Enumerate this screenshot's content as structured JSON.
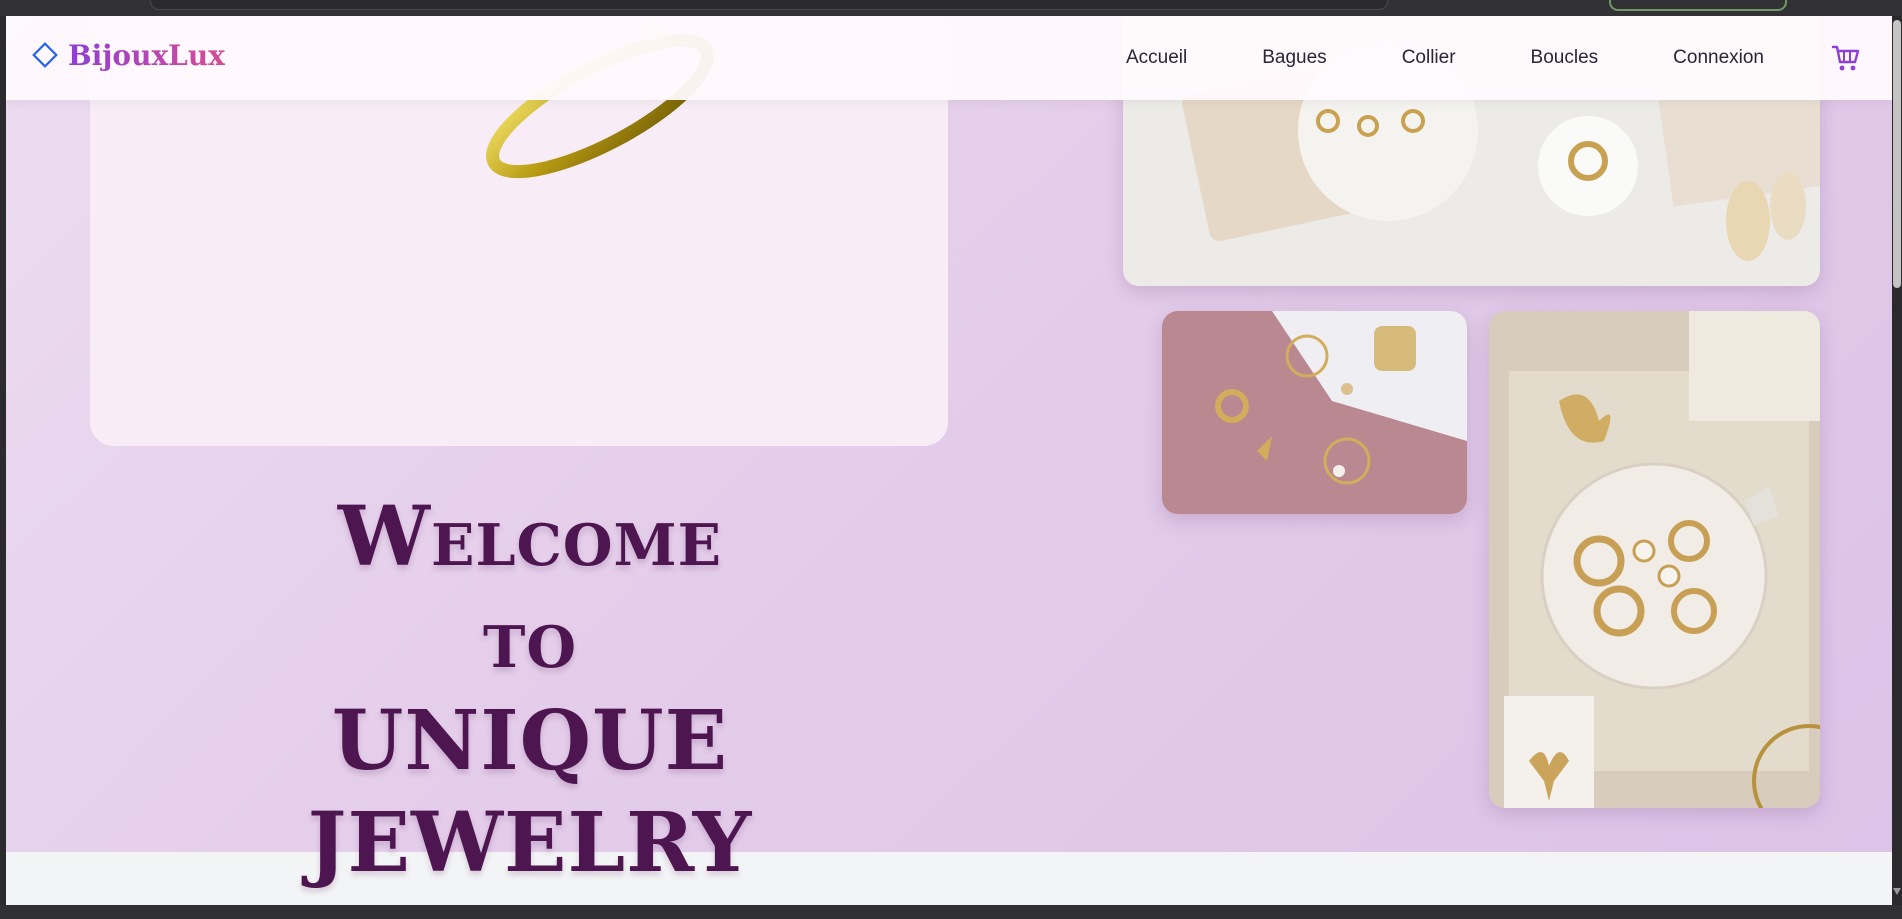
{
  "brand": {
    "name": "BijouxLux",
    "icon": "diamond-outline-icon"
  },
  "nav": {
    "links": [
      "Accueil",
      "Bagues",
      "Collier",
      "Boucles",
      "Connexion"
    ],
    "cart_icon": "shopping-cart-icon"
  },
  "hero": {
    "title_lines": [
      "Welcome",
      "to",
      "UNIQUE JEWELRY"
    ]
  },
  "colors": {
    "accent": "#8e3fd6",
    "brand_gradient_end": "#d84c92",
    "title": "#4e1650",
    "hero_bg": "#e4cdea",
    "card_bg": "#f8edf6"
  }
}
